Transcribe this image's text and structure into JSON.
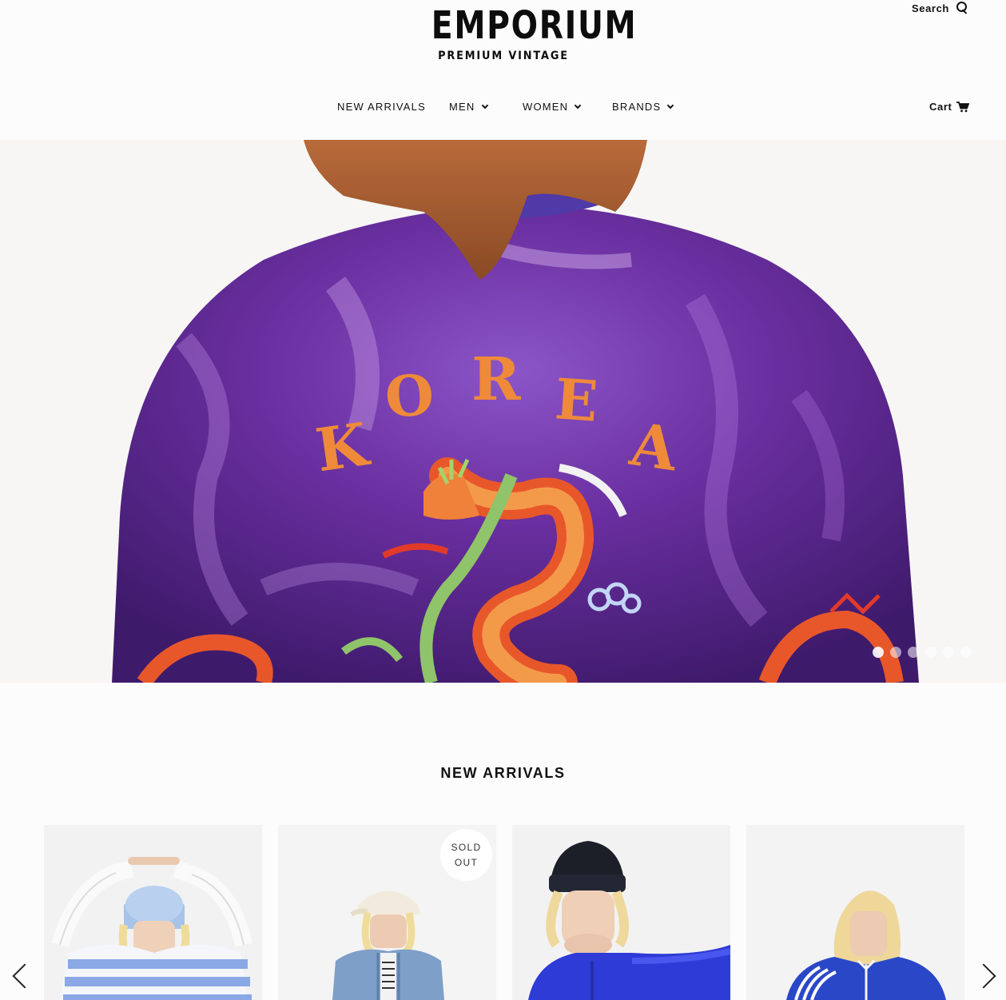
{
  "header": {
    "logo_main": "EMPORIUM",
    "logo_sub": "PREMIUM VINTAGE",
    "search_label": "Search",
    "search_icon": "search-icon",
    "cart_label": "Cart",
    "cart_icon": "cart-icon"
  },
  "nav": {
    "items": [
      {
        "label": "NEW ARRIVALS",
        "dropdown": false
      },
      {
        "label": "MEN",
        "dropdown": true
      },
      {
        "label": "WOMEN",
        "dropdown": true
      },
      {
        "label": "BRANDS",
        "dropdown": true
      }
    ]
  },
  "hero": {
    "embroidery_text": [
      "K",
      "O",
      "R",
      "E",
      "A"
    ],
    "slide_count": 6,
    "active_slide": 1
  },
  "new_arrivals": {
    "title": "NEW ARRIVALS",
    "products": [
      {
        "badge": ""
      },
      {
        "badge_line1": "SOLD",
        "badge_line2": "OUT"
      },
      {
        "badge": ""
      },
      {
        "badge": ""
      }
    ],
    "prev_icon": "chevron-left-icon",
    "next_icon": "chevron-right-icon"
  },
  "colors": {
    "background": "#fcfcfc",
    "jacket_purple": "#5a2a8c",
    "embroidery_orange": "#ef8a3c",
    "text": "#111111"
  }
}
